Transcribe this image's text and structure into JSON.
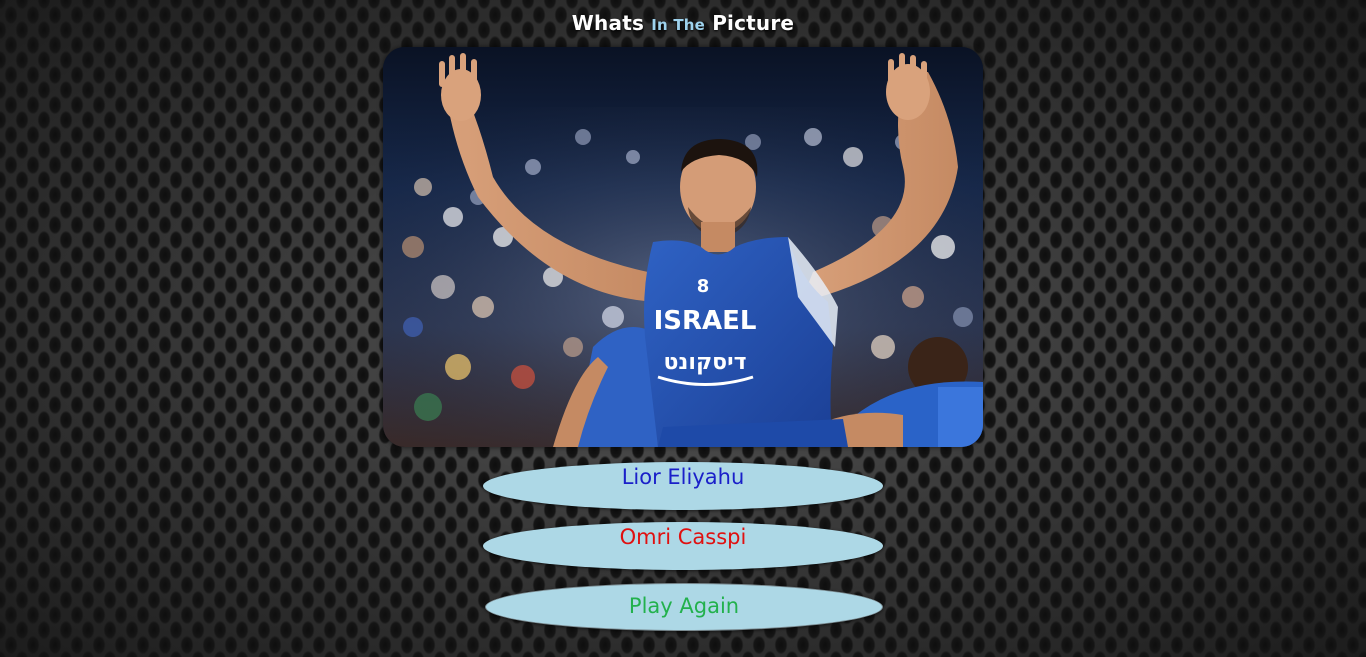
{
  "title": {
    "part1": "Whats",
    "part2": "In The",
    "part3": "Picture"
  },
  "photo": {
    "description": "basketball player with raised arms",
    "jersey_text": "ISRAEL",
    "jersey_sponsor": "דיסקונט",
    "jersey_number": "8"
  },
  "answers": [
    {
      "label": "Lior Eliyahu",
      "color": "#1a20c9"
    },
    {
      "label": "Omri Casspi",
      "color": "#e01010"
    }
  ],
  "play_again": {
    "label": "Play Again",
    "color": "#22b14c"
  }
}
